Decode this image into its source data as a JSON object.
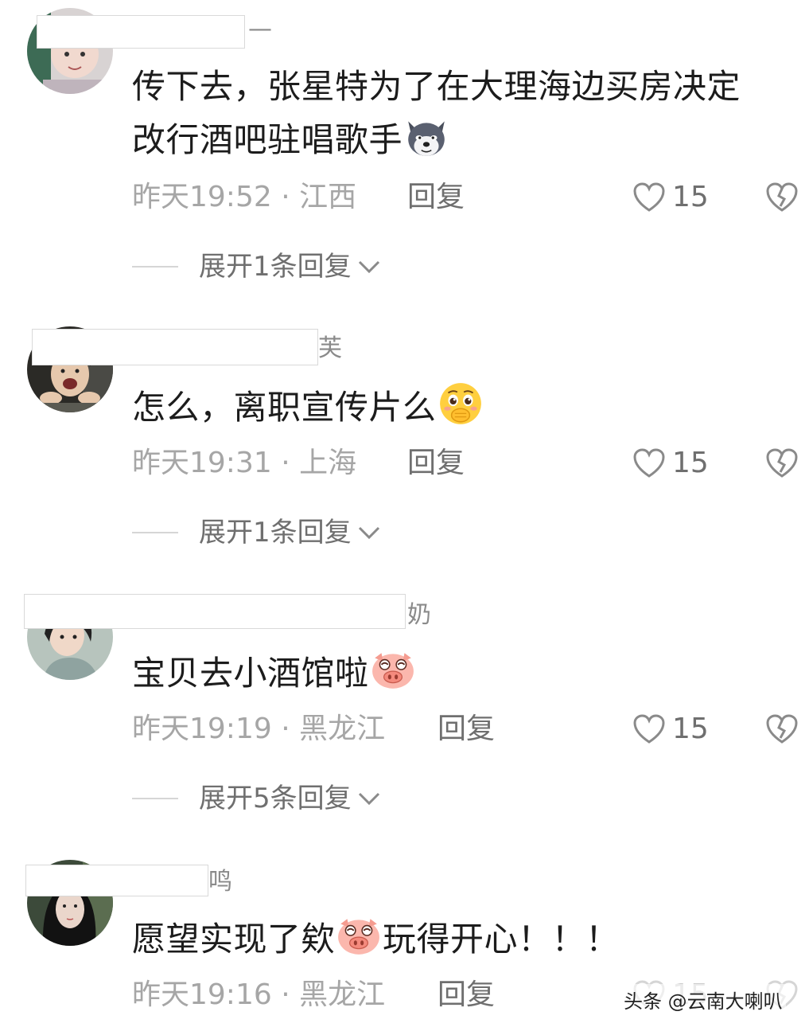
{
  "comments": [
    {
      "name_visible": "—",
      "text_lines": [
        "传下去，张星特为了在大理海边买房决定",
        "改行酒吧驻唱歌手"
      ],
      "emoji": "husky-dog-emoji",
      "time": "昨天19:52",
      "separator": "·",
      "location": "江西",
      "reply_label": "回复",
      "likes": "15",
      "expand_label": "展开1条回复"
    },
    {
      "name_visible": "芙",
      "text_lines": [
        "怎么，离职宣传片么"
      ],
      "emoji": "blushing-face-emoji",
      "time": "昨天19:31",
      "separator": "·",
      "location": "上海",
      "reply_label": "回复",
      "likes": "15",
      "expand_label": "展开1条回复"
    },
    {
      "name_visible": "奶",
      "text_lines": [
        "宝贝去小酒馆啦"
      ],
      "emoji": "pig-face-emoji",
      "time": "昨天19:19",
      "separator": "·",
      "location": "黑龙江",
      "reply_label": "回复",
      "likes": "15",
      "expand_label": "展开5条回复"
    },
    {
      "name_visible": "鸣",
      "text_before": "愿望实现了欸",
      "text_after": "玩得开心！！！",
      "emoji": "pig-face-emoji",
      "time": "昨天19:16",
      "separator": "·",
      "location": "黑龙江",
      "reply_label": "回复",
      "likes": "15"
    }
  ],
  "watermark": "头条 @云南大喇叭",
  "colors": {
    "text": "#1c1c1c",
    "meta": "#a6a6a6",
    "action": "#6f6f6f",
    "divider": "#d6d6d6"
  },
  "icons": {
    "like": "heart-outline-icon",
    "dislike": "broken-heart-icon",
    "expand": "chevron-down-icon"
  }
}
